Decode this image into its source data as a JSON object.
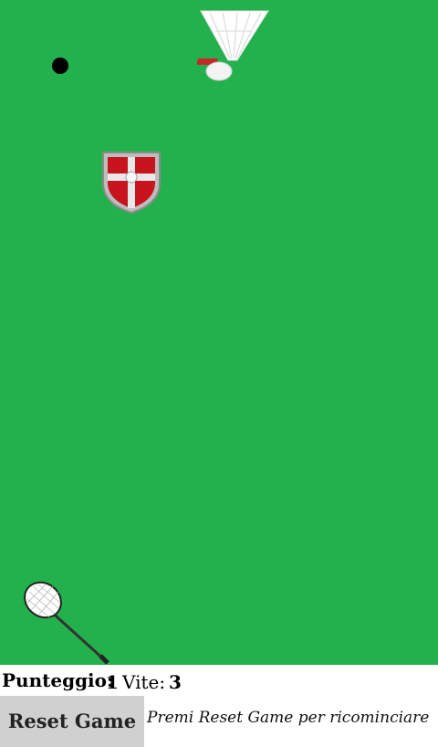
{
  "hud": {
    "score_label": "Punteggio:",
    "score_value": "1",
    "lives_label": "Vite:",
    "lives_value": "3"
  },
  "controls": {
    "reset_label": "Reset Game",
    "hint": "Premi Reset Game per ricominciare"
  },
  "colors": {
    "field": "#22b14c",
    "ball": "#000000",
    "shield": "#c8141e",
    "reset_button": "#d0d0d0"
  },
  "sprites": {
    "ball": "ball-icon",
    "shuttlecock": "shuttlecock-icon",
    "shield": "shield-icon",
    "racket": "racket-icon"
  }
}
